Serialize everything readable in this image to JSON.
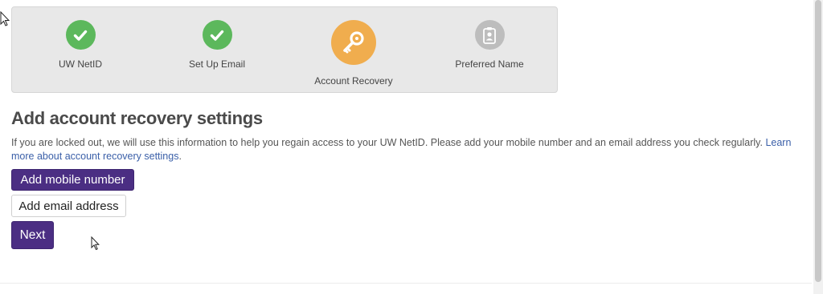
{
  "steps": [
    {
      "label": "UW NetID",
      "state": "done",
      "icon": "check-icon"
    },
    {
      "label": "Set Up Email",
      "state": "done",
      "icon": "check-icon"
    },
    {
      "label": "Account Recovery",
      "state": "active",
      "icon": "key-icon"
    },
    {
      "label": "Preferred Name",
      "state": "pending",
      "icon": "id-badge-icon"
    }
  ],
  "main": {
    "heading": "Add account recovery settings",
    "description": "If you are locked out, we will use this information to help you regain access to your UW NetID. Please add your mobile number and an email address you check regularly. ",
    "link_text": "Learn more about account recovery settings",
    "description_end": "."
  },
  "buttons": {
    "add_mobile": "Add mobile number",
    "add_email": "Add email address",
    "next": "Next"
  },
  "colors": {
    "uw_purple": "#4b2e83",
    "done_green": "#5cb85c",
    "active_orange": "#f0ad4e",
    "pending_gray": "#bdbdbd",
    "link_blue": "#3a5fa8"
  }
}
